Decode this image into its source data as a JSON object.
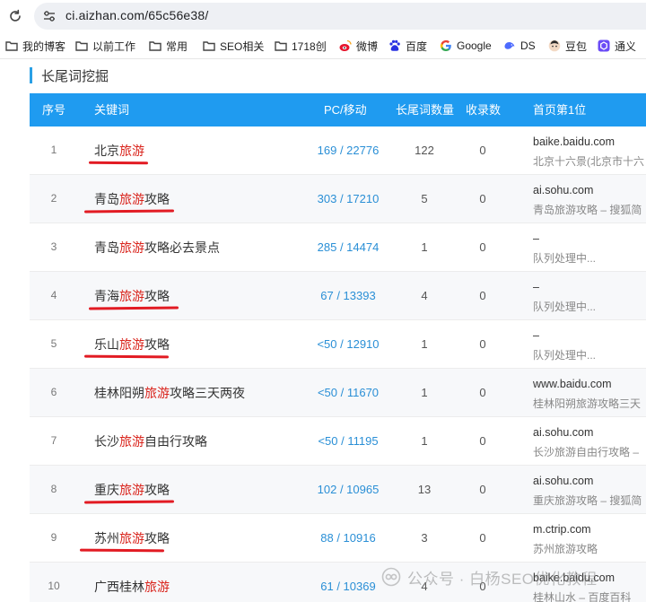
{
  "browser": {
    "url": "ci.aizhan.com/65c56e38/",
    "bookmarks": [
      {
        "label": "我的博客",
        "icon": "folder-icon"
      },
      {
        "label": "以前工作",
        "icon": "folder-icon"
      },
      {
        "label": "常用",
        "icon": "folder-icon"
      },
      {
        "label": "SEO相关",
        "icon": "folder-icon"
      },
      {
        "label": "1718创",
        "icon": "folder-icon"
      },
      {
        "label": "微博",
        "icon": "weibo-icon"
      },
      {
        "label": "百度",
        "icon": "baidu-icon"
      },
      {
        "label": "Google",
        "icon": "google-icon"
      },
      {
        "label": "DS",
        "icon": "deepseek-icon"
      },
      {
        "label": "豆包",
        "icon": "doubao-icon"
      },
      {
        "label": "通义",
        "icon": "tongyi-icon"
      }
    ]
  },
  "section": {
    "title": "长尾词挖掘"
  },
  "table": {
    "headers": [
      "序号",
      "关键词",
      "PC/移动",
      "长尾词数量",
      "收录数",
      "首页第1位"
    ],
    "rows": [
      {
        "num": "1",
        "kw_pre": "北京",
        "kw_red": "旅游",
        "kw_post": "",
        "pc": "169 / 22776",
        "longtail": "122",
        "indexed": "0",
        "domain": "baike.baidu.com",
        "title": "北京十六景(北京市十六",
        "underlined": true
      },
      {
        "num": "2",
        "kw_pre": "青岛",
        "kw_red": "旅游",
        "kw_post": "攻略",
        "pc": "303 / 17210",
        "longtail": "5",
        "indexed": "0",
        "domain": "ai.sohu.com",
        "title": "青岛旅游攻略 – 搜狐简",
        "underlined": true
      },
      {
        "num": "3",
        "kw_pre": "青岛",
        "kw_red": "旅游",
        "kw_post": "攻略必去景点",
        "pc": "285 / 14474",
        "longtail": "1",
        "indexed": "0",
        "domain": "–",
        "title": "队列处理中...",
        "underlined": false
      },
      {
        "num": "4",
        "kw_pre": "青海",
        "kw_red": "旅游",
        "kw_post": "攻略",
        "pc": "67 / 13393",
        "longtail": "4",
        "indexed": "0",
        "domain": "–",
        "title": "队列处理中...",
        "underlined": true
      },
      {
        "num": "5",
        "kw_pre": "乐山",
        "kw_red": "旅游",
        "kw_post": "攻略",
        "pc": "<50 / 12910",
        "longtail": "1",
        "indexed": "0",
        "domain": "–",
        "title": "队列处理中...",
        "underlined": true
      },
      {
        "num": "6",
        "kw_pre": "桂林阳朔",
        "kw_red": "旅游",
        "kw_post": "攻略三天两夜",
        "pc": "<50 / 11670",
        "longtail": "1",
        "indexed": "0",
        "domain": "www.baidu.com",
        "title": "桂林阳朔旅游攻略三天",
        "underlined": false
      },
      {
        "num": "7",
        "kw_pre": "长沙",
        "kw_red": "旅游",
        "kw_post": "自由行攻略",
        "pc": "<50 / 11195",
        "longtail": "1",
        "indexed": "0",
        "domain": "ai.sohu.com",
        "title": "长沙旅游自由行攻略 – ",
        "underlined": false
      },
      {
        "num": "8",
        "kw_pre": "重庆",
        "kw_red": "旅游",
        "kw_post": "攻略",
        "pc": "102 / 10965",
        "longtail": "13",
        "indexed": "0",
        "domain": "ai.sohu.com",
        "title": "重庆旅游攻略 – 搜狐简",
        "underlined": true
      },
      {
        "num": "9",
        "kw_pre": "苏州",
        "kw_red": "旅游",
        "kw_post": "攻略",
        "pc": "88 / 10916",
        "longtail": "3",
        "indexed": "0",
        "domain": "m.ctrip.com",
        "title": "苏州旅游攻略",
        "underlined": true
      },
      {
        "num": "10",
        "kw_pre": "广西桂林",
        "kw_red": "旅游",
        "kw_post": "",
        "pc": "61 / 10369",
        "longtail": "4",
        "indexed": "0",
        "domain": "baike.baidu.com",
        "title": "桂林山水 – 百度百科",
        "underlined": false
      }
    ]
  },
  "watermark": {
    "text": "公众号 · 白杨SEO优化教程",
    "icon": "wechat-official-icon"
  },
  "colors": {
    "header_bg": "#1f9bf0",
    "accent_red": "#d9231b",
    "link_blue": "#2a8fd6",
    "underline_red": "#e21b23"
  }
}
